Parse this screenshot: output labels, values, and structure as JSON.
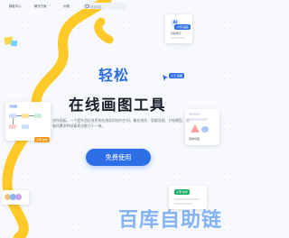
{
  "nav": {
    "items": [
      "模板中心",
      "解决方案",
      "价格"
    ],
    "search_placeholder": "搜索模板"
  },
  "hero": {
    "headline": "轻松",
    "title": "在线画图工具",
    "description": "协作画板，一个提升团队效率的在线实时协作空间，集在线作、思维导图、分析模型、头脑风暴多种创意表达能力于一体。",
    "cta_label": "免费使用"
  },
  "cards": {
    "ai_card": {
      "badge": "AI",
      "label": "智能助手",
      "pill": "小明·画图"
    },
    "flow_card": {
      "title": "流程图",
      "pill": "小王·画图"
    },
    "mindmap_card": {
      "label": "思维导图"
    },
    "right_card": {
      "pill": "小李·协作"
    },
    "avatars_card": {
      "label": "头像"
    }
  },
  "watermark": "百库自助链",
  "colors": {
    "brand_blue": "#2e6fe8",
    "ribbon_yellow": "#ffc928",
    "text_dark": "#1b1f2a"
  }
}
